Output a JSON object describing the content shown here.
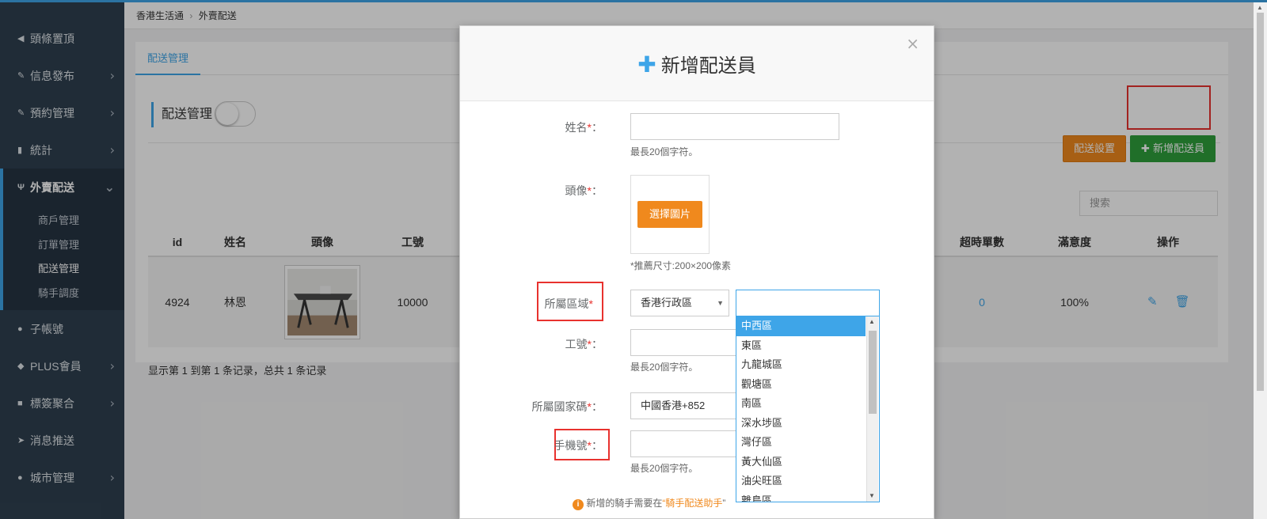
{
  "sidebar": {
    "items": [
      {
        "icon": "megaphone-icon",
        "glyph": "◀",
        "label": "頭條置頂",
        "chevron": false
      },
      {
        "icon": "edit-icon",
        "glyph": "✎",
        "label": "信息發布",
        "chevron": true
      },
      {
        "icon": "edit-icon",
        "glyph": "✎",
        "label": "預約管理",
        "chevron": true
      },
      {
        "icon": "bar-chart-icon",
        "glyph": "▮",
        "label": "統計",
        "chevron": true
      },
      {
        "icon": "cutlery-icon",
        "glyph": "Ψ",
        "label": "外賣配送",
        "expanded": true
      },
      {
        "icon": "user-icon",
        "glyph": "●",
        "label": "子帳號",
        "chevron": false
      },
      {
        "icon": "diamond-icon",
        "glyph": "◆",
        "label": "PLUS會員",
        "chevron": true
      },
      {
        "icon": "tag-icon",
        "glyph": "■",
        "label": "標簽聚合",
        "chevron": true
      },
      {
        "icon": "send-icon",
        "glyph": "➤",
        "label": "消息推送",
        "chevron": false
      },
      {
        "icon": "map-marker-icon",
        "glyph": "●",
        "label": "城市管理",
        "chevron": true
      }
    ],
    "subitems": [
      "商戶管理",
      "訂單管理",
      "配送管理",
      "騎手調度"
    ]
  },
  "breadcrumb": {
    "home": "香港生活通",
    "current": "外賣配送"
  },
  "page": {
    "tab": "配送管理",
    "section_title": "配送管理",
    "btn_settings": "配送設置",
    "btn_add": "新增配送員",
    "search_placeholder": "搜索"
  },
  "table": {
    "headers": {
      "id": "id",
      "name": "姓名",
      "avatar": "頭像",
      "jobno": "工號",
      "overtime": "超時單數",
      "satisfaction": "滿意度",
      "ops": "操作"
    },
    "row": {
      "id": "4924",
      "name": "林恩",
      "jobno": "10000",
      "overtime": "0",
      "satisfaction": "100%"
    },
    "footer": "显示第 1 到第 1 条记录，总共 1 条记录"
  },
  "modal": {
    "title": "新增配送員",
    "close": "×",
    "name_label": "姓名",
    "name_hint": "最長20個字符。",
    "avatar_label": "頭像",
    "avatar_button": "選擇圖片",
    "avatar_hint": "*推薦尺寸:200×200像素",
    "region_label": "所屬區域",
    "region_value": "香港行政區",
    "jobno_label": "工號",
    "jobno_hint": "最長20個字符。",
    "country_label": "所屬國家碼",
    "country_value": "中國香港+852",
    "phone_label": "手機號",
    "phone_hint": "最長20個字符。",
    "note_prefix": "新增的騎手需要在",
    "note_link": "“騎手配送助手",
    "note_suffix": "”"
  },
  "district_options": [
    "中西區",
    "東區",
    "九龍城區",
    "觀塘區",
    "南區",
    "深水埗區",
    "灣仔區",
    "黃大仙區",
    "油尖旺區",
    "離島區"
  ],
  "colors": {
    "accent": "#3ea5e8",
    "orange": "#f0891d",
    "green": "#2f9f3c",
    "highlight": "#e8322e",
    "sidebar": "#2f4050"
  }
}
